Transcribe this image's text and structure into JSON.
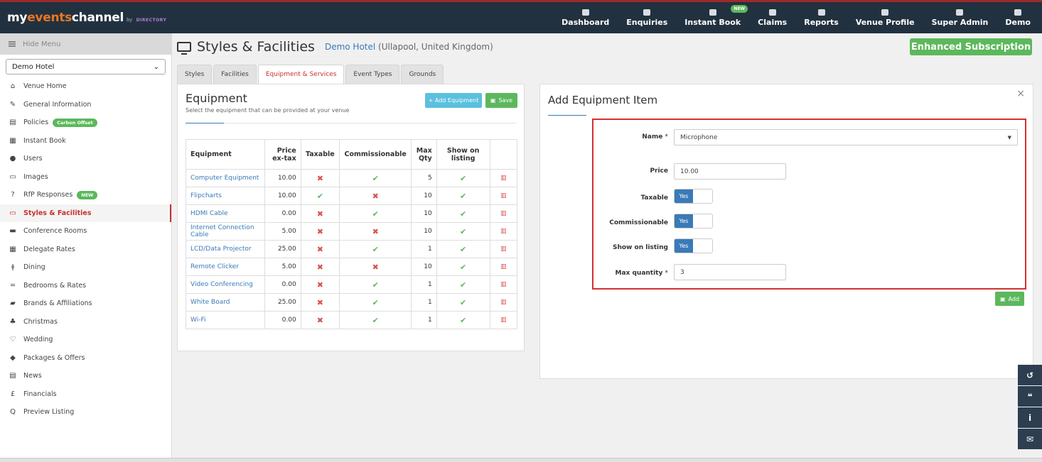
{
  "brand": {
    "part1": "my",
    "part2": "events",
    "part3": "channel",
    "by": "by",
    "dir": "DIRECTORY"
  },
  "nav": [
    {
      "label": "Dashboard",
      "icon": "dashboard-icon"
    },
    {
      "label": "Enquiries",
      "icon": "envelope-icon"
    },
    {
      "label": "Instant Book",
      "icon": "calendar-icon",
      "badge": "NEW"
    },
    {
      "label": "Claims",
      "icon": "book-icon"
    },
    {
      "label": "Reports",
      "icon": "bar-chart-icon"
    },
    {
      "label": "Venue Profile",
      "icon": "building-icon"
    },
    {
      "label": "Super Admin",
      "icon": "lock-icon"
    },
    {
      "label": "Demo",
      "icon": "user-icon"
    }
  ],
  "sidebar": {
    "hide_menu": "Hide Menu",
    "venue": "Demo Hotel",
    "items": [
      {
        "label": "Venue Home",
        "icon": "home-icon",
        "glyph": "⌂"
      },
      {
        "label": "General Information",
        "icon": "edit-icon",
        "glyph": "✎"
      },
      {
        "label": "Policies",
        "icon": "file-icon",
        "glyph": "▤",
        "badge": "Carbon Offset"
      },
      {
        "label": "Instant Book",
        "icon": "calendar-icon",
        "glyph": "▦"
      },
      {
        "label": "Users",
        "icon": "user-icon",
        "glyph": "●"
      },
      {
        "label": "Images",
        "icon": "image-icon",
        "glyph": "▭"
      },
      {
        "label": "RfP Responses",
        "icon": "question-icon",
        "glyph": "?",
        "badge": "NEW"
      },
      {
        "label": "Styles & Facilities",
        "icon": "monitor-icon",
        "glyph": "▭",
        "active": true
      },
      {
        "label": "Conference Rooms",
        "icon": "briefcase-icon",
        "glyph": "▬"
      },
      {
        "label": "Delegate Rates",
        "icon": "calculator-icon",
        "glyph": "▦"
      },
      {
        "label": "Dining",
        "icon": "cutlery-icon",
        "glyph": "ǂ"
      },
      {
        "label": "Bedrooms & Rates",
        "icon": "bed-icon",
        "glyph": "═"
      },
      {
        "label": "Brands & Affiliations",
        "icon": "book-icon",
        "glyph": "▰"
      },
      {
        "label": "Christmas",
        "icon": "tree-icon",
        "glyph": "♣"
      },
      {
        "label": "Wedding",
        "icon": "heart-icon",
        "glyph": "♡"
      },
      {
        "label": "Packages & Offers",
        "icon": "tags-icon",
        "glyph": "◆"
      },
      {
        "label": "News",
        "icon": "newspaper-icon",
        "glyph": "▤"
      },
      {
        "label": "Financials",
        "icon": "pound-icon",
        "glyph": "£"
      },
      {
        "label": "Preview Listing",
        "icon": "search-icon",
        "glyph": "Q"
      }
    ]
  },
  "header": {
    "title": "Styles & Facilities",
    "hotel_link": "Demo Hotel",
    "hotel_location": "(Ullapool, United Kingdom)",
    "subscription": "Enhanced Subscription"
  },
  "tabs": [
    {
      "label": "Styles"
    },
    {
      "label": "Facilities"
    },
    {
      "label": "Equipment & Services",
      "active": true
    },
    {
      "label": "Event Types"
    },
    {
      "label": "Grounds"
    }
  ],
  "equipment": {
    "title": "Equipment",
    "subtitle": "Select the equipment that can be provided at your venue",
    "add_button": "+ Add Equipment",
    "save_button": "Save",
    "columns": [
      "Equipment",
      "Price ex-tax",
      "Taxable",
      "Commissionable",
      "Max Qty",
      "Show on listing",
      ""
    ],
    "rows": [
      {
        "name": "Computer Equipment",
        "price": "10.00",
        "taxable": false,
        "commissionable": true,
        "max_qty": "5",
        "show": true
      },
      {
        "name": "Flipcharts",
        "price": "10.00",
        "taxable": true,
        "commissionable": false,
        "max_qty": "10",
        "show": true
      },
      {
        "name": "HDMI Cable",
        "price": "0.00",
        "taxable": false,
        "commissionable": true,
        "max_qty": "10",
        "show": true
      },
      {
        "name": "Internet Connection Cable",
        "price": "5.00",
        "taxable": false,
        "commissionable": false,
        "max_qty": "10",
        "show": true
      },
      {
        "name": "LCD/Data Projector",
        "price": "25.00",
        "taxable": false,
        "commissionable": true,
        "max_qty": "1",
        "show": true
      },
      {
        "name": "Remote Clicker",
        "price": "5.00",
        "taxable": false,
        "commissionable": false,
        "max_qty": "10",
        "show": true
      },
      {
        "name": "Video Conferencing",
        "price": "0.00",
        "taxable": false,
        "commissionable": true,
        "max_qty": "1",
        "show": true
      },
      {
        "name": "White Board",
        "price": "25.00",
        "taxable": false,
        "commissionable": true,
        "max_qty": "1",
        "show": true
      },
      {
        "name": "Wi-Fi",
        "price": "0.00",
        "taxable": false,
        "commissionable": true,
        "max_qty": "1",
        "show": true
      }
    ]
  },
  "add_item": {
    "title": "Add Equipment Item",
    "close": "×",
    "name_label": "Name",
    "name_value": "Microphone",
    "price_label": "Price",
    "price_value": "10.00",
    "taxable_label": "Taxable",
    "taxable_value": "Yes",
    "commissionable_label": "Commissionable",
    "commissionable_value": "Yes",
    "show_label": "Show on listing",
    "show_value": "Yes",
    "max_label": "Max quantity",
    "max_value": "3",
    "required_mark": "*",
    "add_button": "Add"
  },
  "floating": [
    {
      "icon": "history-icon",
      "glyph": "↺"
    },
    {
      "icon": "chat-icon",
      "glyph": "❝"
    },
    {
      "icon": "info-icon",
      "glyph": "i"
    },
    {
      "icon": "envelope-icon",
      "glyph": "✉"
    }
  ]
}
